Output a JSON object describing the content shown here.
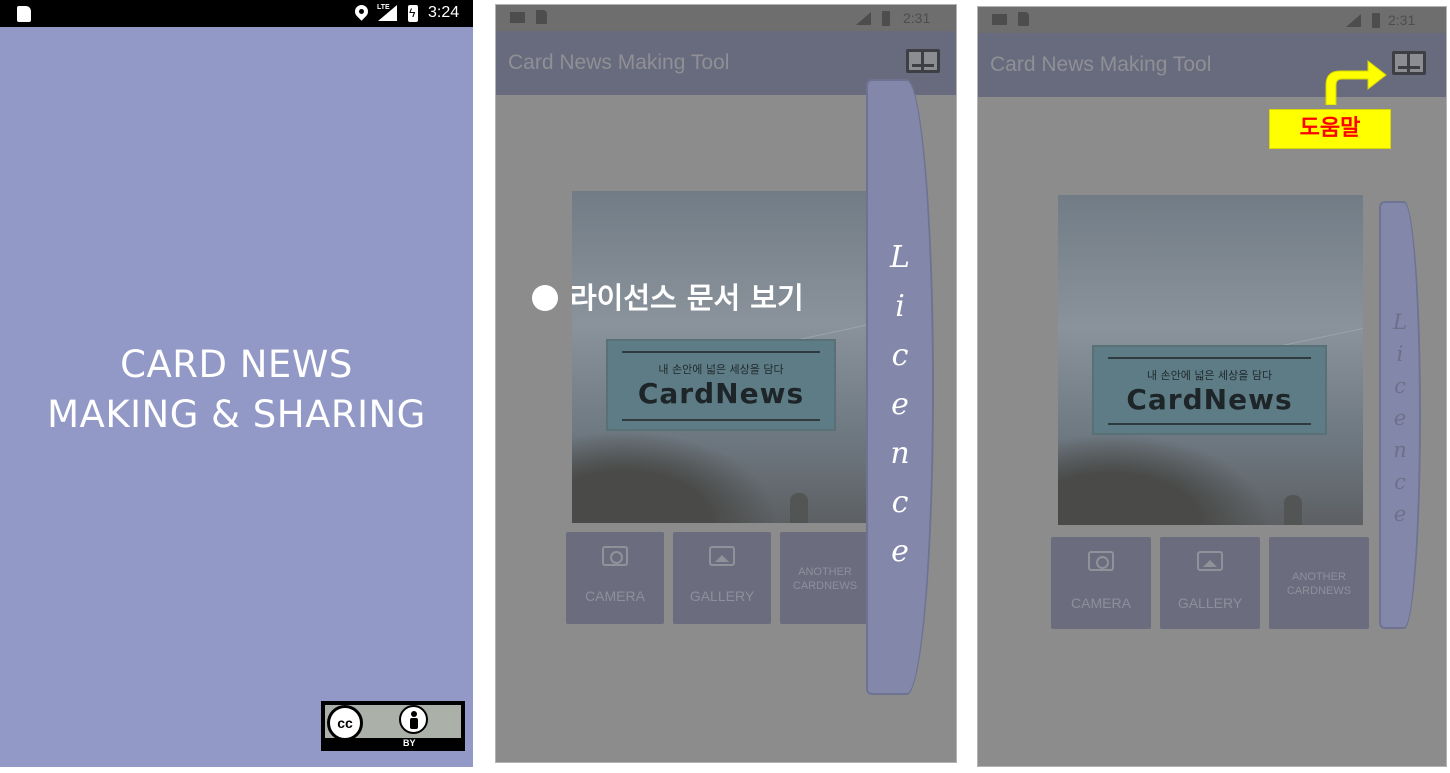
{
  "screen1": {
    "status_time": "3:24",
    "status_network": "LTE",
    "title_line1": "CARD NEWS",
    "title_line2": "MAKING & SHARING",
    "license_cc": "cc",
    "license_by": "BY"
  },
  "screen2": {
    "status_time": "2:31",
    "app_title": "Card News Making Tool",
    "logo_tagline": "내 손안에 넓은 세상을 담다",
    "logo_text": "CardNews",
    "buttons": {
      "camera": "CAMERA",
      "gallery": "GALLERY",
      "another_line1": "ANOTHER",
      "another_line2": "CARDNEWS"
    },
    "licence_tab": [
      "L",
      "i",
      "c",
      "e",
      "n",
      "c",
      "e"
    ],
    "annotation": "라이선스 문서 보기"
  },
  "screen3": {
    "status_time": "2:31",
    "app_title": "Card News Making Tool",
    "logo_tagline": "내 손안에 넓은 세상을 담다",
    "logo_text": "CardNews",
    "buttons": {
      "camera": "CAMERA",
      "gallery": "GALLERY",
      "another_line1": "ANOTHER",
      "another_line2": "CARDNEWS"
    },
    "licence_tab": [
      "L",
      "i",
      "c",
      "e",
      "n",
      "c",
      "e"
    ],
    "help_label": "도움말"
  },
  "colors": {
    "splash_bg": "#9299c7",
    "overlay_gray": "#8c8c8c",
    "licence_tab": "#8387a9",
    "help_label_bg": "#ffff00",
    "help_label_text": "#ff0000",
    "help_arrow": "#ffff00"
  },
  "icons": [
    "sd-card-icon",
    "location-icon",
    "signal-icon",
    "battery-icon",
    "mail-icon",
    "book-icon",
    "camera-icon",
    "gallery-icon",
    "cc-icon",
    "attribution-icon",
    "curved-arrow-icon",
    "bullet-icon"
  ]
}
